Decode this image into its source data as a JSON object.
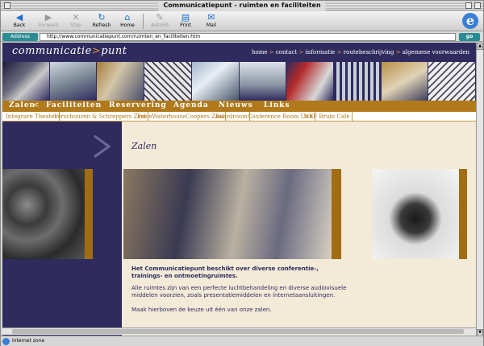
{
  "window": {
    "title": "Communicatiepunt - ruimten en faciliteiten"
  },
  "toolbar": {
    "back": "Back",
    "forward": "Forward",
    "stop": "Stop",
    "refresh": "Refresh",
    "home": "Home",
    "autofill": "AutoFill",
    "print": "Print",
    "mail": "Mail"
  },
  "address": {
    "label": "Address",
    "url": "http://www.communicatiepunt.com/ruimten_en_faciliteiten.htm",
    "go": "go"
  },
  "site": {
    "logo_main": "communicatie",
    "logo_sep": ">",
    "logo_accent": "punt",
    "topnav": [
      "home",
      "contact",
      "informatie",
      "routebeschrijving",
      "algemene voorwaarden"
    ],
    "topnav_sep": ">",
    "mainnav": [
      "Zalen",
      "Faciliteiten",
      "Reservering",
      "Agenda",
      "Nieuws",
      "Links"
    ],
    "mainnav_arrow": "<",
    "subnav": [
      "Integrare Theater",
      "Verschuuren & Schreppers Zaal",
      "PriceWaterhouseCoopers Zaal",
      "Boardroom",
      "Conference Room Unit",
      "NKF Bruin Café"
    ],
    "page_title": "Zalen",
    "intro_bold": "Het Communicatiepunt beschikt over diverse conferentie-, trainings- en ontmoetingruimtes.",
    "intro_1": "Alle ruimtes zijn van een perfecte luchtbehandeling en diverse audiovisuele middelen voorzien, zoals presentatiemiddelen en internetaansluitingen.",
    "intro_2": "Maak hierboven de keuze uit één van onze zalen."
  },
  "status": {
    "zone": "Internet zone"
  },
  "colors": {
    "brand_navy": "#2f2b5e",
    "brand_gold": "#b07a1c",
    "page_bg": "#f3ead8"
  }
}
